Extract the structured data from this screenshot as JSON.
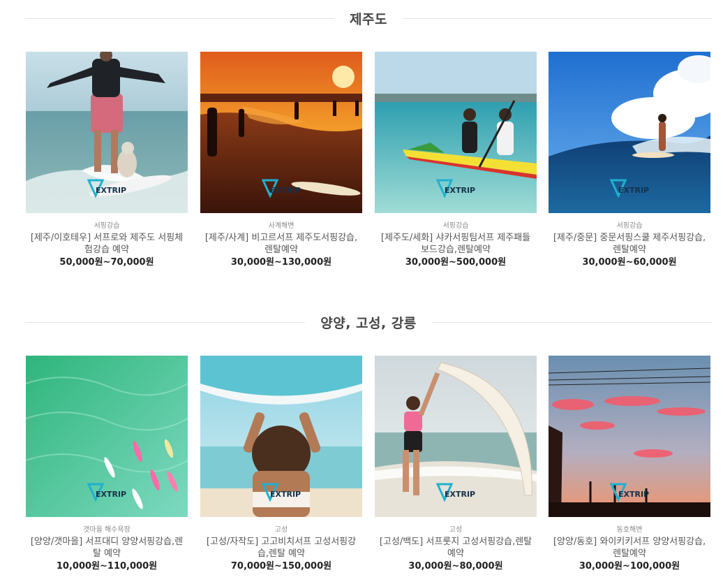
{
  "sections": [
    {
      "title": "제주도",
      "items": [
        {
          "category": "서핑강습",
          "name": "[제주/이호테우] 서프로와 제주도 서핑체험강습 예약",
          "price": "50,000원~70,000원",
          "logo": "EXTRIP"
        },
        {
          "category": "사계해변",
          "name": "[제주/사계] 비고르서프 제주도서핑강습, 렌탈예약",
          "price": "30,000원~130,000원",
          "logo": "EXTRIP"
        },
        {
          "category": "서핑강습",
          "name": "[제주도/세화] 샤카서핑팀서프 제주패들보드강습,렌탈예약",
          "price": "30,000원~500,000원",
          "logo": "EXTRIP"
        },
        {
          "category": "서핑강습",
          "name": "[제주/중문] 중문서핑스쿨 제주서핑강습,렌탈예약",
          "price": "30,000원~60,000원",
          "logo": "EXTRIP"
        }
      ]
    },
    {
      "title": "양양, 고성, 강릉",
      "items": [
        {
          "category": "갯마을 해수욕장",
          "name": "[양양/갯마을] 서프대디 양양서핑강습,렌탈 예약",
          "price": "10,000원~110,000원",
          "logo": "EXTRIP"
        },
        {
          "category": "고성",
          "name": "[고성/자작도] 고고비치서프 고성서핑강습,렌탈 예약",
          "price": "70,000원~150,000원",
          "logo": "EXTRIP"
        },
        {
          "category": "고성",
          "name": "[고성/백도] 서프룻지 고성서핑강습,렌탈예약",
          "price": "30,000원~80,000원",
          "logo": "EXTRIP"
        },
        {
          "category": "동호해변",
          "name": "[양양/동호] 와이키키서프 양양서핑강습,렌탈예약",
          "price": "30,000원~100,000원",
          "logo": "EXTRIP"
        }
      ]
    }
  ]
}
